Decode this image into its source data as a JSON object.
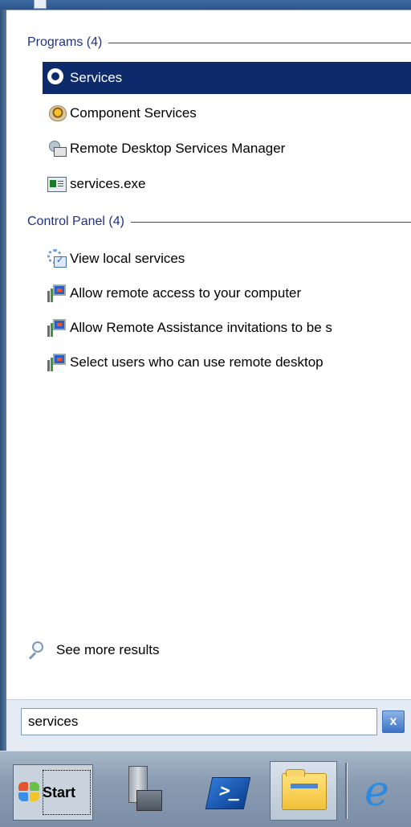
{
  "start_menu": {
    "groups": [
      {
        "title": "Programs (4)",
        "items": [
          {
            "label": "Services",
            "icon": "services-gear-icon",
            "selected": true
          },
          {
            "label": "Component Services",
            "icon": "component-services-icon"
          },
          {
            "label": "Remote Desktop Services Manager",
            "icon": "remote-desktop-services-icon"
          },
          {
            "label": "services.exe",
            "icon": "exe-file-icon"
          }
        ]
      },
      {
        "title": "Control Panel (4)",
        "items": [
          {
            "label": "View local services",
            "icon": "view-local-services-icon"
          },
          {
            "label": "Allow remote access to your computer",
            "icon": "control-panel-system-icon"
          },
          {
            "label": "Allow Remote Assistance invitations to be s",
            "icon": "control-panel-system-icon"
          },
          {
            "label": "Select users who can use remote desktop",
            "icon": "control-panel-system-icon"
          }
        ]
      }
    ],
    "see_more": "See more results",
    "search": {
      "value": "services",
      "clear_icon": "x"
    }
  },
  "taskbar": {
    "start_label": "Start",
    "pinned": [
      "server-manager-icon",
      "powershell-icon",
      "windows-explorer-icon",
      "internet-explorer-icon"
    ]
  },
  "colors": {
    "selection": "#0d2b6a",
    "header_text": "#1e3287"
  }
}
